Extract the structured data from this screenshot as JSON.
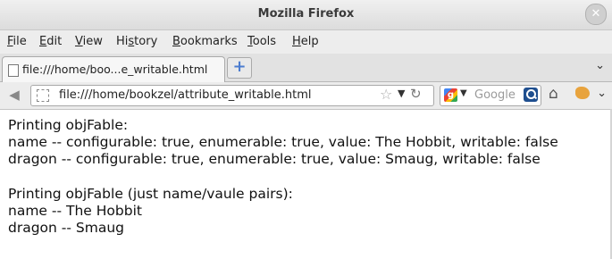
{
  "window": {
    "title": "Mozilla Firefox",
    "close_glyph": "✕"
  },
  "menu": [
    {
      "key": "F",
      "rest": "ile"
    },
    {
      "key": "E",
      "rest": "dit"
    },
    {
      "key": "V",
      "rest": "iew"
    },
    {
      "pre": "Hi",
      "key": "s",
      "rest": "tory"
    },
    {
      "key": "B",
      "rest": "ookmarks"
    },
    {
      "key": "T",
      "rest": "ools"
    },
    {
      "key": "H",
      "rest": "elp"
    }
  ],
  "tabs": {
    "active_label": "file:///home/boo...e_writable.html"
  },
  "navbar": {
    "url": "file:///home/bookzel/attribute_writable.html",
    "search_placeholder": "Google"
  },
  "icons": {
    "close": "close-icon",
    "page": "page-icon",
    "new_tab": "plus-icon",
    "back": "back-arrow-icon",
    "star": "star-icon",
    "reload": "reload-icon",
    "search_engine": "google-icon",
    "magnifier": "search-icon",
    "home": "home-icon",
    "addon": "firebug-icon"
  },
  "page": {
    "lines": [
      "Printing objFable:",
      "name -- configurable: true, enumerable: true, value: The Hobbit, writable: false",
      "dragon -- configurable: true, enumerable: true, value: Smaug, writable: false",
      "",
      "Printing objFable (just name/vaule pairs):",
      "name -- The Hobbit",
      "dragon -- Smaug"
    ]
  }
}
